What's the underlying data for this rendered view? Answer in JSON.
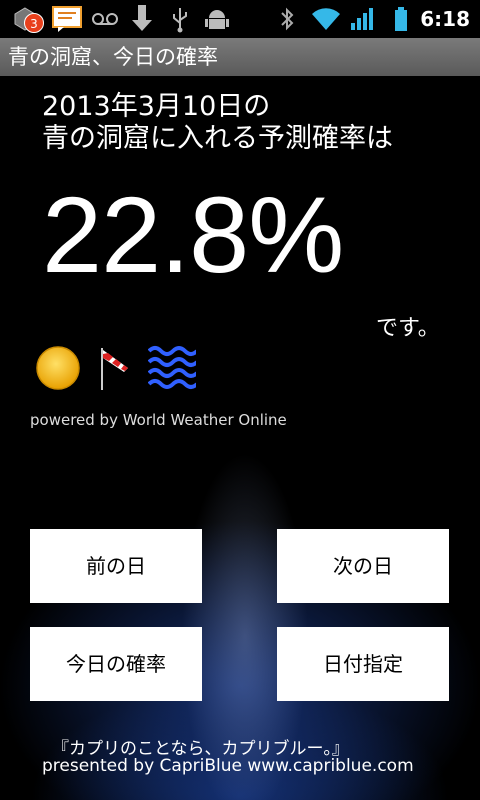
{
  "status_bar": {
    "notification_badge": "3",
    "time": "6:18",
    "icons": [
      "app-icon",
      "message-icon",
      "voicemail-icon",
      "download-icon",
      "usb-icon",
      "android-debug-icon",
      "bluetooth-icon",
      "wifi-icon",
      "signal-icon",
      "battery-icon"
    ]
  },
  "app": {
    "title": "青の洞窟、今日の確率"
  },
  "main": {
    "date_text": "2013年3月10日の",
    "question_text": "青の洞窟に入れる予測確率は",
    "probability": "22.8%",
    "suffix": "です。",
    "weather_icons": [
      "sun-icon",
      "windsock-icon",
      "waves-icon"
    ],
    "powered_by": "powered by World Weather Online"
  },
  "buttons": {
    "prev_day": "前の日",
    "next_day": "次の日",
    "today": "今日の確率",
    "date_select": "日付指定"
  },
  "footer": {
    "quote": "『カプリのことなら、カプリブルー。』",
    "presented_by": "presented by CapriBlue www.capriblue.com"
  },
  "colors": {
    "title_bar": "#6a6a6a",
    "background": "#000000",
    "water_blue": "#1d3f8f",
    "badge": "#e8401c"
  }
}
